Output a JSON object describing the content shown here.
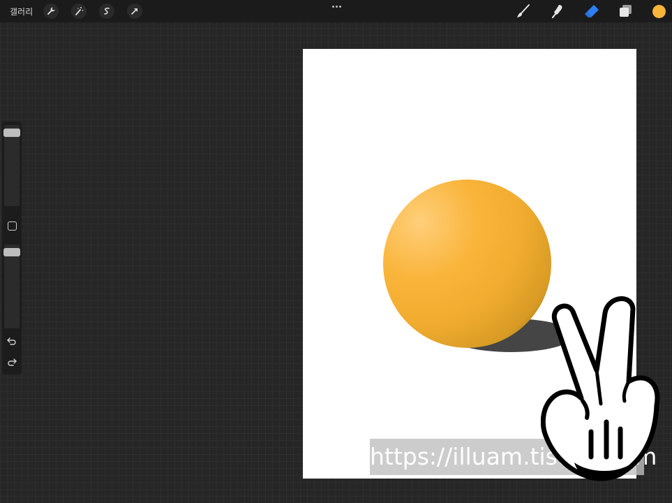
{
  "topbar": {
    "gallery_label": "갤러리",
    "left_tools": [
      "wrench-icon",
      "magic-wand-icon",
      "selection-icon",
      "transform-arrow-icon"
    ],
    "right_tools": [
      "brush-icon",
      "smudge-icon",
      "eraser-icon",
      "layers-icon"
    ],
    "active_tool": "eraser",
    "current_color": "#f9b43a",
    "active_tool_color": "#2d7ff9"
  },
  "sidebar": {
    "brush_size_level": 0.95,
    "opacity_level": 0.95,
    "icons": [
      "modify-square-icon",
      "undo-icon",
      "redo-icon"
    ]
  },
  "canvas": {
    "background": "#ffffff",
    "sphere_color": "#f9b43a",
    "shadow_color": "#454545"
  },
  "overlay": {
    "watermark": "https://illuam.tistory.com",
    "gesture": "two-finger-tap-hand-icon"
  }
}
